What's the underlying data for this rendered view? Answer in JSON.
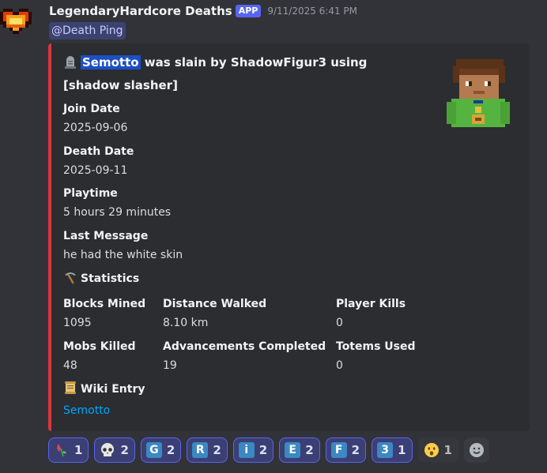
{
  "message": {
    "author": "LegendaryHardcore Deaths",
    "badge": "APP",
    "timestamp": "9/11/2025 6:41 PM",
    "mention": "@Death Ping"
  },
  "embed": {
    "accent_color": "#da373c",
    "title_player": "Semotto",
    "title_rest": " was slain by ShadowFigur3 using [shadow slasher]",
    "fields": {
      "join_date": {
        "name": "Join Date",
        "value": "2025-09-06"
      },
      "death_date": {
        "name": "Death Date",
        "value": "2025-09-11"
      },
      "playtime": {
        "name": "Playtime",
        "value": "5 hours 29 minutes"
      },
      "last_message": {
        "name": "Last Message",
        "value": "he had the white skin"
      }
    },
    "statistics_heading": "Statistics",
    "stats": {
      "blocks_mined": {
        "name": "Blocks Mined",
        "value": "1095"
      },
      "distance_walked": {
        "name": "Distance Walked",
        "value": "8.10 km"
      },
      "player_kills": {
        "name": "Player Kills",
        "value": "0"
      },
      "mobs_killed": {
        "name": "Mobs Killed",
        "value": "48"
      },
      "advancements": {
        "name": "Advancements Completed",
        "value": "19"
      },
      "totems_used": {
        "name": "Totems Used",
        "value": "0"
      }
    },
    "wiki_heading": "Wiki Entry",
    "wiki_link": "Semotto"
  },
  "reactions": [
    {
      "icon": "hibiscus-emoji",
      "count": "1"
    },
    {
      "icon": "skull-emoji",
      "count": "2"
    },
    {
      "icon": "letter-g-emoji",
      "letter": "G",
      "count": "2"
    },
    {
      "icon": "letter-r-emoji",
      "letter": "R",
      "count": "2"
    },
    {
      "icon": "letter-i-emoji",
      "letter": "i",
      "count": "2"
    },
    {
      "icon": "letter-e-emoji",
      "letter": "E",
      "count": "2"
    },
    {
      "icon": "letter-f-emoji",
      "letter": "F",
      "count": "2"
    },
    {
      "icon": "number-3-emoji",
      "letter": "3",
      "count": "1"
    },
    {
      "icon": "hushed-face-emoji",
      "count": "1"
    }
  ]
}
